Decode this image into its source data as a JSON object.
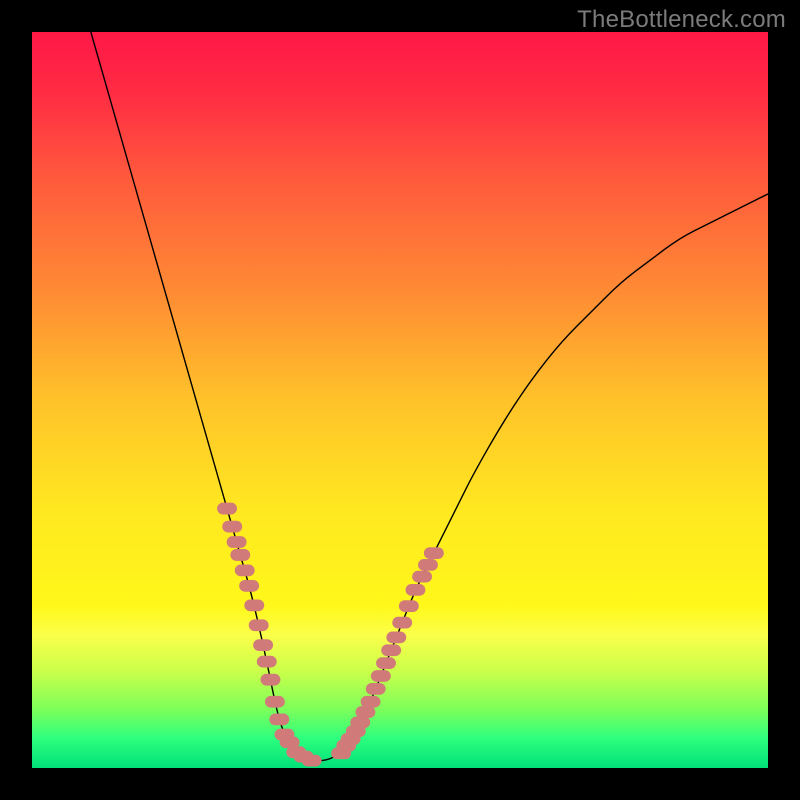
{
  "watermark": "TheBottleneck.com",
  "colors": {
    "frame": "#000000",
    "curve_stroke": "#000000",
    "markers_color": "#d17a7a",
    "watermark_text": "#7b7b7b",
    "gradient_stops": [
      {
        "offset": 0.0,
        "color": "#ff1846"
      },
      {
        "offset": 0.08,
        "color": "#ff2b44"
      },
      {
        "offset": 0.2,
        "color": "#ff5a3c"
      },
      {
        "offset": 0.35,
        "color": "#ff8a34"
      },
      {
        "offset": 0.5,
        "color": "#ffc22a"
      },
      {
        "offset": 0.65,
        "color": "#ffe820"
      },
      {
        "offset": 0.78,
        "color": "#fff81a"
      },
      {
        "offset": 0.82,
        "color": "#faff4a"
      },
      {
        "offset": 0.87,
        "color": "#c8ff4a"
      },
      {
        "offset": 0.92,
        "color": "#7dff5a"
      },
      {
        "offset": 0.96,
        "color": "#2dff7e"
      },
      {
        "offset": 1.0,
        "color": "#00e079"
      }
    ]
  },
  "chart_data": {
    "type": "line",
    "title": "",
    "xlabel": "",
    "ylabel": "",
    "xlim": [
      0,
      100
    ],
    "ylim": [
      0,
      100
    ],
    "series": [
      {
        "name": "curve",
        "x": [
          8,
          10,
          12,
          14,
          16,
          18,
          20,
          22,
          24,
          26,
          28,
          30,
          32,
          33,
          34,
          36,
          38,
          40,
          42,
          44,
          46,
          48,
          50,
          52,
          54,
          56,
          58,
          60,
          64,
          68,
          72,
          76,
          80,
          84,
          88,
          92,
          96,
          100
        ],
        "y": [
          100,
          93,
          86,
          79,
          72,
          65,
          58,
          51,
          44,
          37,
          30,
          23,
          14,
          9,
          5,
          2,
          1,
          1,
          2,
          5,
          9,
          14,
          19,
          24,
          28,
          32,
          36,
          40,
          47,
          53,
          58,
          62,
          66,
          69,
          72,
          74,
          76,
          78
        ]
      }
    ],
    "markers": [
      {
        "name": "left-cluster",
        "x": [
          26.5,
          27.2,
          27.8,
          28.3,
          28.9,
          29.5,
          30.2,
          30.8,
          31.4,
          31.9,
          32.4,
          33.0,
          33.6,
          34.3,
          35.0,
          35.9,
          36.9,
          38.0
        ],
        "y_from_curve": true
      },
      {
        "name": "right-cluster",
        "x": [
          42.0,
          42.7,
          43.3,
          44.0,
          44.6,
          45.3,
          46.0,
          46.7,
          47.4,
          48.1,
          48.8,
          49.5,
          50.3,
          51.2,
          52.1,
          53.0,
          53.8,
          54.6
        ],
        "y_from_curve": true
      }
    ]
  }
}
